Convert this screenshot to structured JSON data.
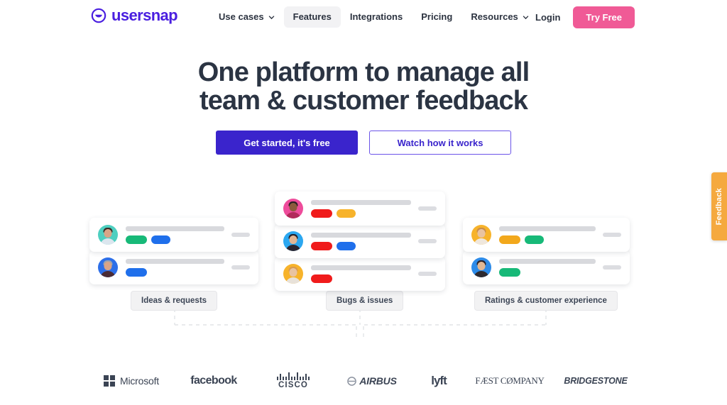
{
  "brand": {
    "name": "usersnap",
    "logo_icon": "usersnap-smile-circle-icon",
    "color": "#4A1FE0"
  },
  "nav": {
    "items": [
      {
        "label": "Use cases",
        "has_caret": true,
        "active": false
      },
      {
        "label": "Features",
        "has_caret": false,
        "active": true
      },
      {
        "label": "Integrations",
        "has_caret": false,
        "active": false
      },
      {
        "label": "Pricing",
        "has_caret": false,
        "active": false
      },
      {
        "label": "Resources",
        "has_caret": true,
        "active": false
      }
    ],
    "login_label": "Login",
    "cta_label": "Try Free",
    "cta_color": "#F05A96"
  },
  "hero": {
    "title_line1": "One platform to manage all",
    "title_line2": "team & customer feedback",
    "primary_cta": "Get started, it's free",
    "secondary_cta": "Watch how it works",
    "primary_color": "#3A24CC"
  },
  "feedback_tab": {
    "label": "Feedback",
    "color": "#F5A93F"
  },
  "illustration": {
    "columns": [
      {
        "chip_label": "Ideas & requests",
        "rows": [
          {
            "avatar_bg": "#4ECFC0",
            "hair": "#3A2A25",
            "skin": "#D9A487",
            "shirt": "#DCE6EE",
            "tags": [
              {
                "color": "#17B978"
              },
              {
                "color": "#1F6FEB"
              }
            ]
          },
          {
            "avatar_bg": "#2D6FE8",
            "hair": "#9BA3AE",
            "skin": "#D9A487",
            "shirt": "#4B2B34",
            "tags": [
              {
                "color": "#1F6FEB"
              }
            ]
          }
        ]
      },
      {
        "chip_label": "Bugs & issues",
        "rows": [
          {
            "avatar_bg": "#EE4C9B",
            "hair": "#2A2024",
            "skin": "#8C5A3C",
            "shirt": "#B12A5B",
            "tags": [
              {
                "color": "#F01B1B"
              },
              {
                "color": "#F7B32B"
              }
            ]
          },
          {
            "avatar_bg": "#2BA7F0",
            "hair": "#24202A",
            "skin": "#E2B694",
            "shirt": "#2B2630",
            "tags": [
              {
                "color": "#F01B1B"
              },
              {
                "color": "#1F6FEB"
              }
            ]
          },
          {
            "avatar_bg": "#F7B32B",
            "hair": "#D99A4E",
            "skin": "#E9C3A0",
            "shirt": "#E8E2DA",
            "tags": [
              {
                "color": "#F01B1B"
              }
            ]
          }
        ]
      },
      {
        "chip_label": "Ratings  & customer experience",
        "rows": [
          {
            "avatar_bg": "#F7B32B",
            "hair": "#C98C4A",
            "skin": "#E9C3A0",
            "shirt": "#EFE7DD",
            "tags": [
              {
                "color": "#F2A81C"
              },
              {
                "color": "#17B978"
              }
            ]
          },
          {
            "avatar_bg": "#2D8BE8",
            "hair": "#2A2228",
            "skin": "#E0B894",
            "shirt": "#2E2A30",
            "tags": [
              {
                "color": "#17B978"
              }
            ]
          }
        ]
      }
    ]
  },
  "logos": [
    {
      "name": "Microsoft"
    },
    {
      "name": "facebook"
    },
    {
      "name": "CISCO"
    },
    {
      "name": "AIRBUS"
    },
    {
      "name": "lyft"
    },
    {
      "name": "FÆST CØMPANY"
    },
    {
      "name": "BRIDGESTONE"
    }
  ]
}
